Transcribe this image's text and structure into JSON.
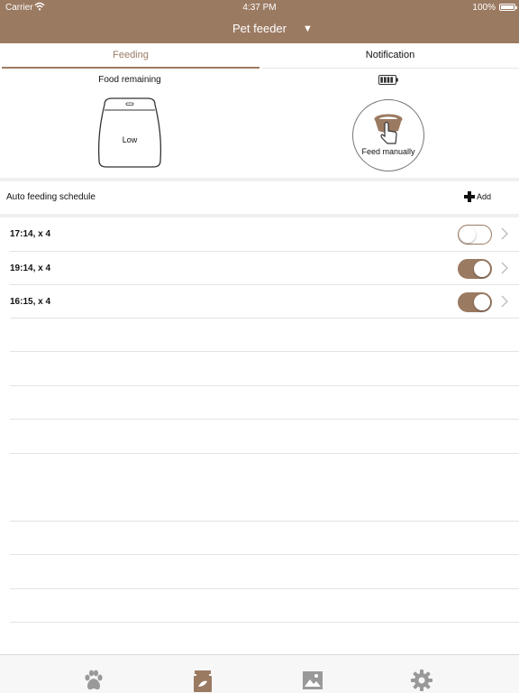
{
  "status_bar": {
    "carrier": "Carrier",
    "time": "4:37 PM",
    "battery": "100%"
  },
  "header": {
    "title": "Pet feeder",
    "dropdown_icon": "triangle-down-icon"
  },
  "tabs": [
    {
      "label": "Feeding",
      "active": true
    },
    {
      "label": "Notification",
      "active": false
    }
  ],
  "food": {
    "label": "Food remaining",
    "level": "Low"
  },
  "feed_manual": {
    "label": "Feed manually"
  },
  "schedule": {
    "title": "Auto feeding schedule",
    "add_label": "Add",
    "items": [
      {
        "label": "17:14, x 4",
        "enabled": false
      },
      {
        "label": "19:14, x 4",
        "enabled": true
      },
      {
        "label": "16:15, x 4",
        "enabled": true
      }
    ]
  },
  "tabbar": [
    "paw-icon",
    "food-bag-icon",
    "gallery-icon",
    "settings-icon"
  ],
  "colors": {
    "accent": "#9b7a62",
    "divider": "#e3e3e3"
  }
}
